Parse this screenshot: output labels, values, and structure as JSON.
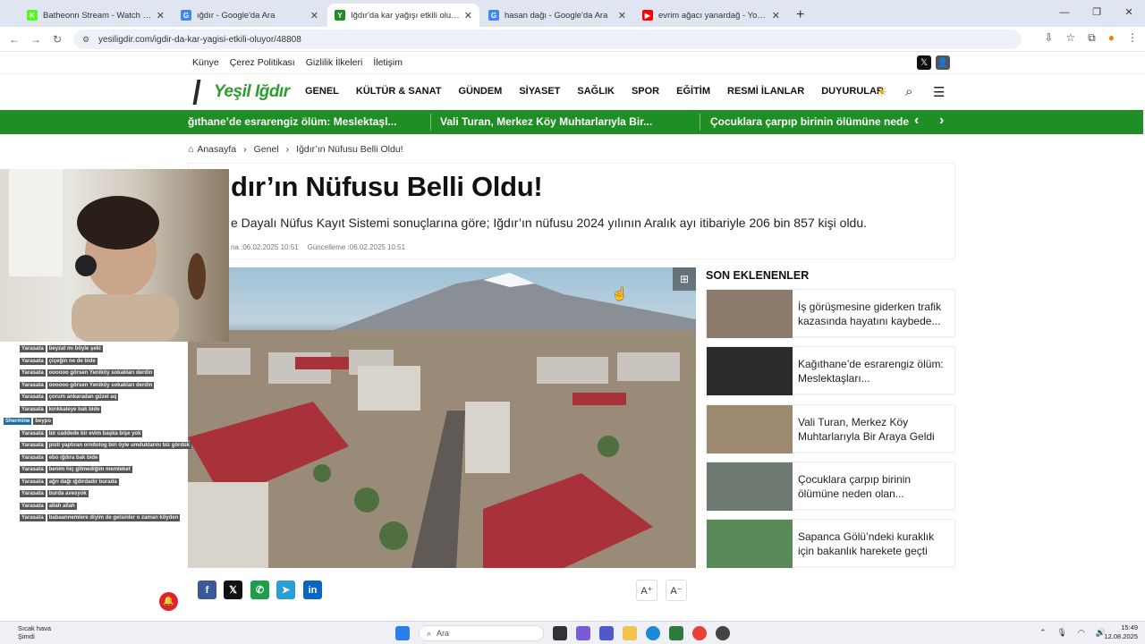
{
  "browser": {
    "tabs": [
      {
        "title": "Batheonn Stream - Watch Live",
        "icon_color": "#53fc18",
        "icon_letter": "K",
        "active": false
      },
      {
        "title": "ığdır - Google'da Ara",
        "icon_color": "#4285f4",
        "icon_letter": "G",
        "active": false
      },
      {
        "title": "Iğdır'da kar yağışı etkili oluyor",
        "icon_color": "#1f8f25",
        "icon_letter": "Y",
        "active": true
      },
      {
        "title": "hasan dağı - Google'da Ara",
        "icon_color": "#4285f4",
        "icon_letter": "G",
        "active": false
      },
      {
        "title": "evrim ağacı yanardağ - YouTube",
        "icon_color": "#ff0000",
        "icon_letter": "▶",
        "active": false
      }
    ],
    "new_tab": "+",
    "url": "yesiligdir.com/igdir-da-kar-yagisi-etkili-oluyor/48808"
  },
  "site": {
    "top_links": [
      "Künye",
      "Çerez Politikası",
      "Gizlilik İlkeleri",
      "İletişim"
    ],
    "logo_text": "Yeşil Iğdır",
    "menu": [
      "GENEL",
      "KÜLTÜR & SANAT",
      "GÜNDEM",
      "SİYASET",
      "SAĞLIK",
      "SPOR",
      "EĞİTİM",
      "RESMİ İLANLAR",
      "DUYURULAR"
    ],
    "brand_color": "#1f8f25"
  },
  "ticker": {
    "items": [
      "ğıthane’de esrarengiz ölüm: Meslektaşl...",
      "Vali Turan, Merkez Köy Muhtarlarıyla Bir...",
      "Çocuklara çarpıp birinin ölümüne nede"
    ]
  },
  "breadcrumb": {
    "home": "Anasayfa",
    "section": "Genel",
    "current": "Iğdır’ın Nüfusu Belli Oldu!"
  },
  "article": {
    "title": "dır’ın Nüfusu Belli Oldu!",
    "summary": "e Dayalı Nüfus Kayıt Sistemi sonuçlarına göre; Iğdır’ın nüfusu 2024 yılının Aralık ayı itibariyle  206 bin 857 kişi oldu.",
    "published": "na :06.02.2025 10:51",
    "updated": "Güncelleme :06.02.2025 10:51"
  },
  "sidebar": {
    "title": "SON EKLENENLER",
    "items": [
      {
        "title": "İş görüşmesine giderken trafik kazasında hayatını kaybede...",
        "thumb": "#8c7b6a"
      },
      {
        "title": "Kağıthane’de esrarengiz ölüm: Meslektaşları...",
        "thumb": "#2b2b2b"
      },
      {
        "title": "Vali Turan, Merkez Köy Muhtarlarıyla Bir Araya Geldi",
        "thumb": "#9c8a70"
      },
      {
        "title": "Çocuklara çarpıp birinin ölümüne neden olan...",
        "thumb": "#6f7a70"
      },
      {
        "title": "Sapanca Gölü’ndeki kuraklık için bakanlık harekete geçti",
        "thumb": "#5a8a5a"
      }
    ]
  },
  "share": {
    "facebook": "f",
    "x": "𝕏",
    "whatsapp": "✆",
    "telegram": "➤",
    "linkedin": "in",
    "font_up": "A⁺",
    "font_down": "A⁻"
  },
  "chat": {
    "messages": [
      {
        "user": "Yarasata",
        "text": "beyzat mı böyle şeki"
      },
      {
        "user": "Yarasata",
        "text": "çiçeğin ne de bide"
      },
      {
        "user": "Yarasata",
        "text": "oooooo görsen Yeniköy sokakları derdin"
      },
      {
        "user": "Yarasata",
        "text": "oooooo görsen Yeniköy sokakları derdin"
      },
      {
        "user": "Yarasata",
        "text": "çorum ankaradan güzel aq"
      },
      {
        "user": "Yarasata",
        "text": "kırıkkaleye bak bide"
      },
      {
        "user": "Shermine",
        "text": "beypo",
        "alt": true
      },
      {
        "user": "Yarasata",
        "text": "bir caddede bir evim başka bişe yok"
      },
      {
        "user": "Yarasata",
        "text": "pisti yaptıran ornitolog biri öyle umduklarını biz gördük"
      },
      {
        "user": "Yarasata",
        "text": "ebo ığdıra bak bide"
      },
      {
        "user": "Yarasata",
        "text": "benim hiç gitmediğim memleket"
      },
      {
        "user": "Yarasata",
        "text": "ağrı dağı ığdırdadır burada"
      },
      {
        "user": "Yarasata",
        "text": "burda avesyok"
      },
      {
        "user": "Yarasata",
        "text": "allah allah"
      },
      {
        "user": "Yarasata",
        "text": "babaannemlere diyim de gelsinler o zaman köyden"
      }
    ]
  },
  "taskbar": {
    "weather_line1": "Sıcak hava",
    "weather_line2": "Şimdi",
    "search_placeholder": "Ara",
    "time": "15:49",
    "date": "12.08.2025"
  }
}
